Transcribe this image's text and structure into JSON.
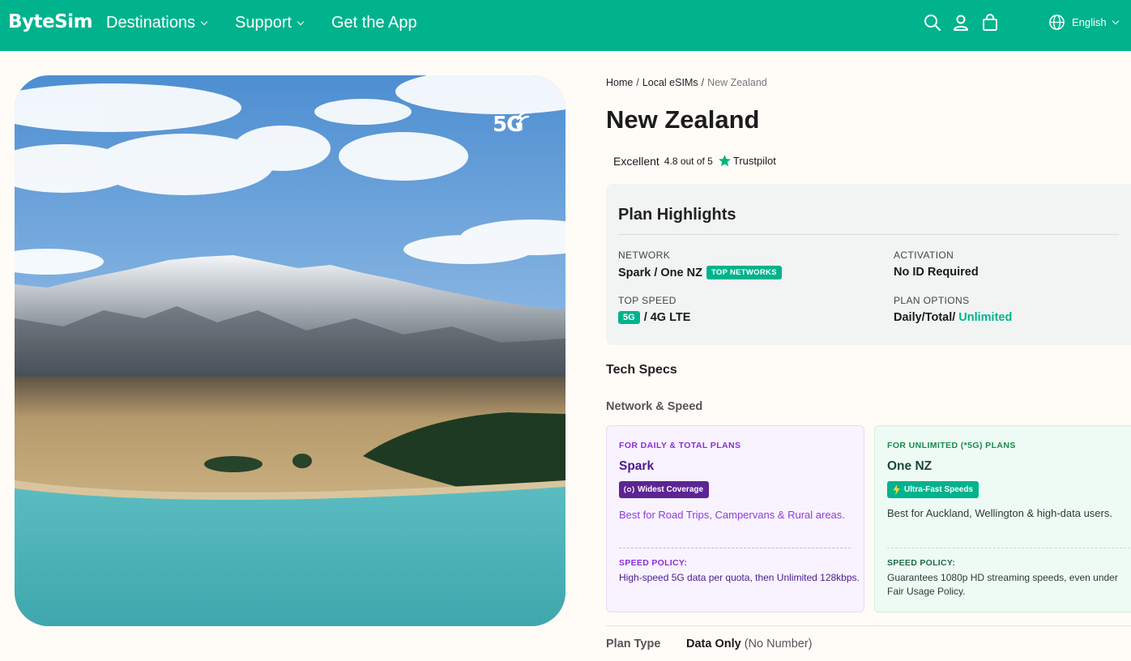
{
  "brand": {
    "name": "ByteSim",
    "accent": "#00b38d"
  },
  "nav": {
    "links": [
      {
        "label": "Destinations",
        "has_dropdown": true
      },
      {
        "label": "Support",
        "has_dropdown": true
      },
      {
        "label": "Get the App",
        "has_dropdown": false
      }
    ],
    "icons": [
      "search-icon",
      "user-icon",
      "bag-icon"
    ],
    "language": {
      "label": "English",
      "icon": "globe-icon"
    }
  },
  "hero": {
    "badge": "5G",
    "badge_icon": "signal-icon"
  },
  "breadcrumb": [
    {
      "label": "Home"
    },
    {
      "label": "Local eSIMs"
    },
    {
      "label": "New Zealand"
    }
  ],
  "page_title": "New Zealand",
  "rating": {
    "label": "Excellent",
    "score_text": "4.8 out of 5",
    "provider": "Trustpilot",
    "star_color": "#00b67a"
  },
  "highlights": {
    "title": "Plan Highlights",
    "network": {
      "label": "NETWORK",
      "value": "Spark / One NZ",
      "badge": "TOP NETWORKS"
    },
    "activation": {
      "label": "ACTIVATION",
      "value": "No ID Required"
    },
    "top_speed": {
      "label": "TOP SPEED",
      "badge": "5G",
      "value": "/ 4G LTE"
    },
    "plan_options": {
      "label": "PLAN OPTIONS",
      "value": "Daily/Total/",
      "highlight": "Unlimited"
    }
  },
  "tech_specs": {
    "title": "Tech Specs",
    "subtitle": "Network & Speed",
    "cards": [
      {
        "caption": "FOR DAILY & TOTAL PLANS",
        "name": "Spark",
        "tag": "Widest Coverage",
        "tag_icon": "satellite-icon",
        "description": "Best for Road Trips, Campervans & Rural areas.",
        "policy_label": "SPEED POLICY:",
        "policy_text": "High-speed 5G data per quota, then Unlimited 128kbps."
      },
      {
        "caption": "FOR UNLIMITED (*5G) PLANS",
        "name": "One NZ",
        "tag": "Ultra-Fast Speeds",
        "tag_icon": "lightning-icon",
        "description": "Best for Auckland, Wellington & high-data users.",
        "policy_label": "SPEED POLICY:",
        "policy_text": "Guarantees 1080p HD streaming speeds, even under Fair Usage Policy."
      }
    ]
  },
  "plan_type": {
    "label": "Plan Type",
    "value": "Data Only",
    "note": "(No Number)"
  }
}
